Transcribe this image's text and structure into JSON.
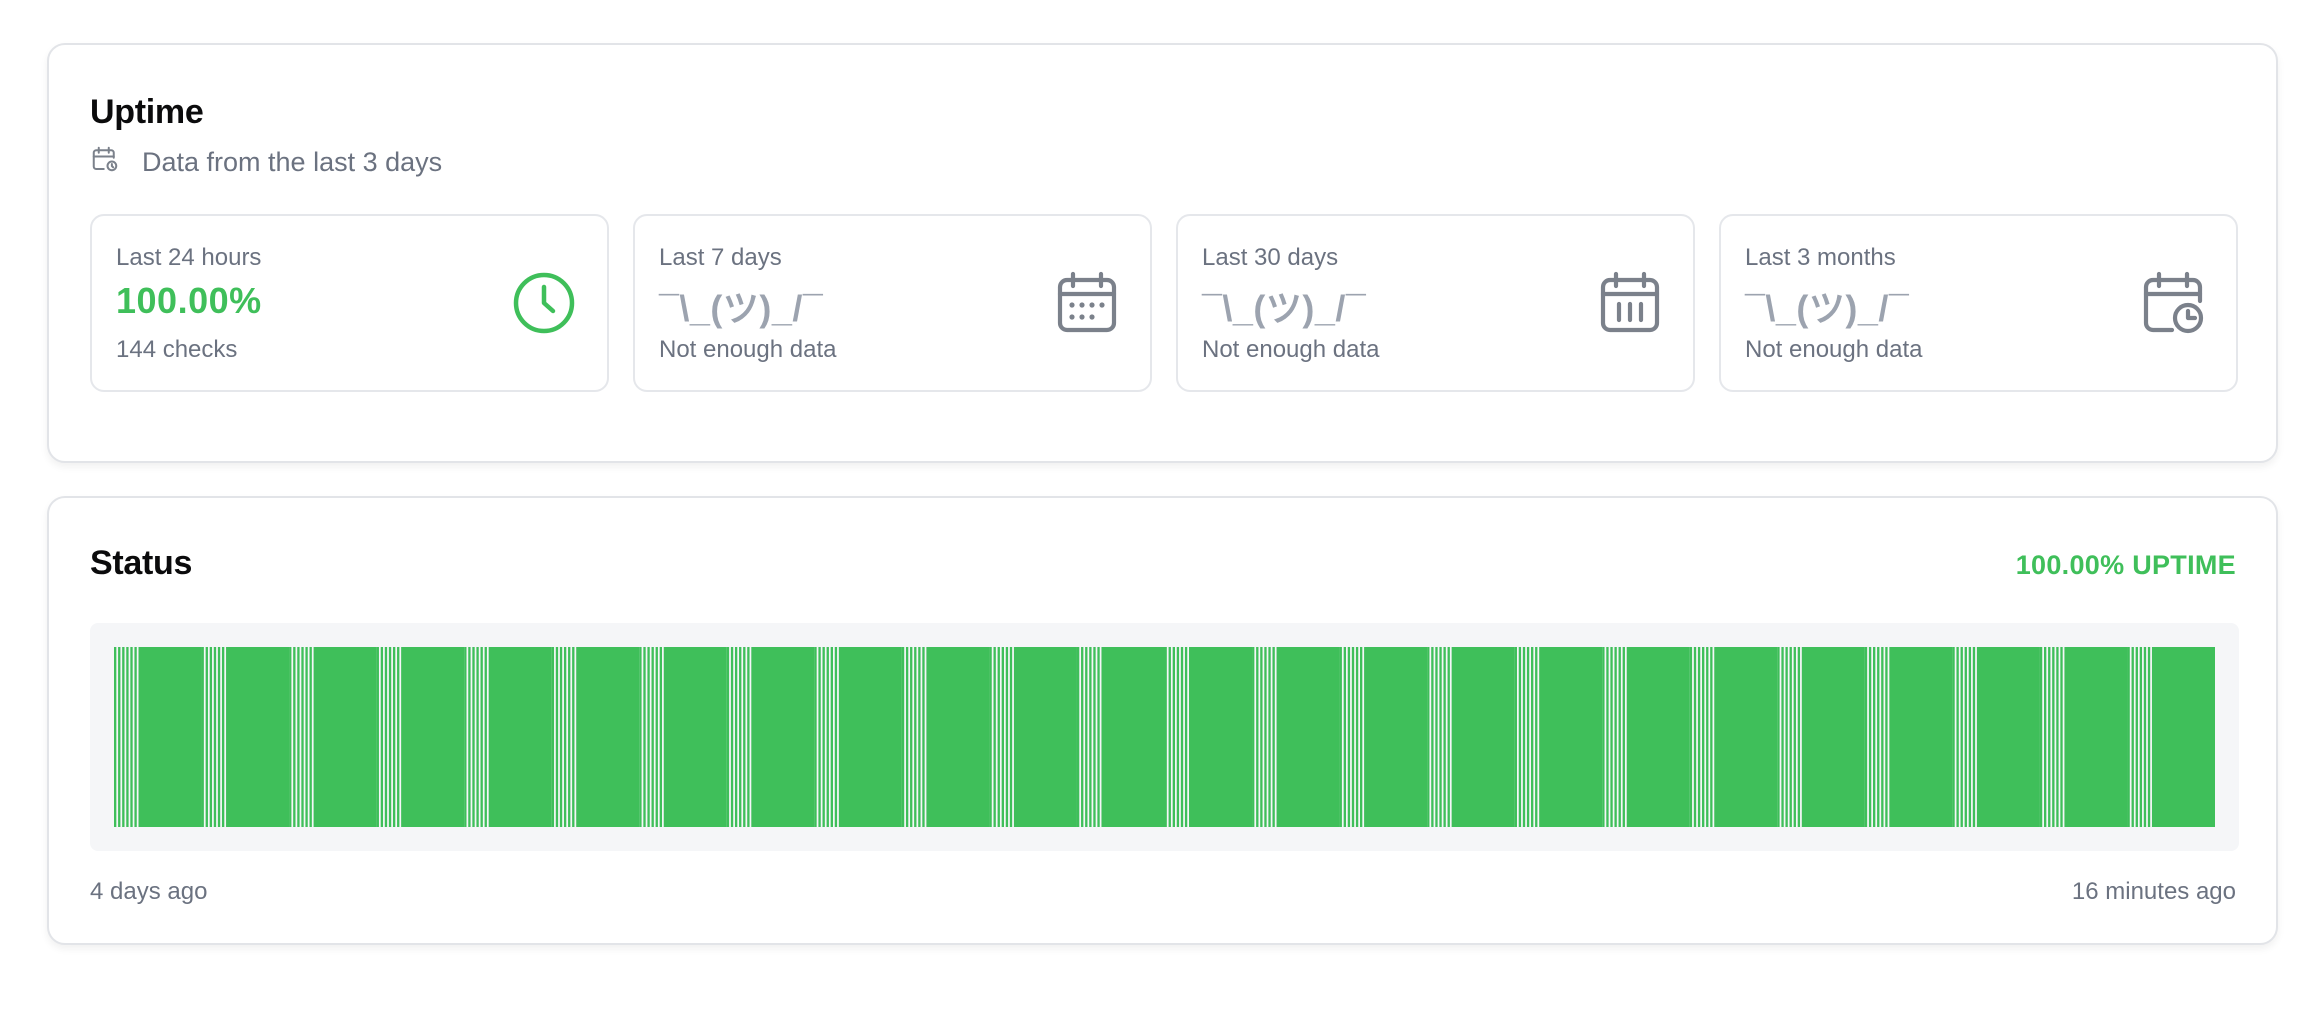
{
  "uptime": {
    "title": "Uptime",
    "subtitle": "Data from the last 3 days",
    "subtitle_icon": "calendar-clock-icon",
    "stats": [
      {
        "label": "Last 24 hours",
        "value": "100.00%",
        "sub": "144 checks",
        "icon": "clock-icon",
        "status": "good"
      },
      {
        "label": "Last 7 days",
        "value": "¯\\_(ツ)_/¯",
        "sub": "Not enough data",
        "icon": "calendar-dots-icon",
        "status": "none"
      },
      {
        "label": "Last 30 days",
        "value": "¯\\_(ツ)_/¯",
        "sub": "Not enough data",
        "icon": "calendar-bars-icon",
        "status": "none"
      },
      {
        "label": "Last 3 months",
        "value": "¯\\_(ツ)_/¯",
        "sub": "Not enough data",
        "icon": "calendar-clock-icon",
        "status": "none"
      }
    ]
  },
  "status": {
    "title": "Status",
    "uptime_label": "100.00% UPTIME",
    "start_label": "4 days ago",
    "end_label": "16 minutes ago",
    "bar_color": "#3fbf5a",
    "check_count": 144,
    "checks_up": 144
  },
  "colors": {
    "good": "#3fbf5a",
    "muted": "#9ca3af",
    "icon_gray": "#7b818b"
  }
}
